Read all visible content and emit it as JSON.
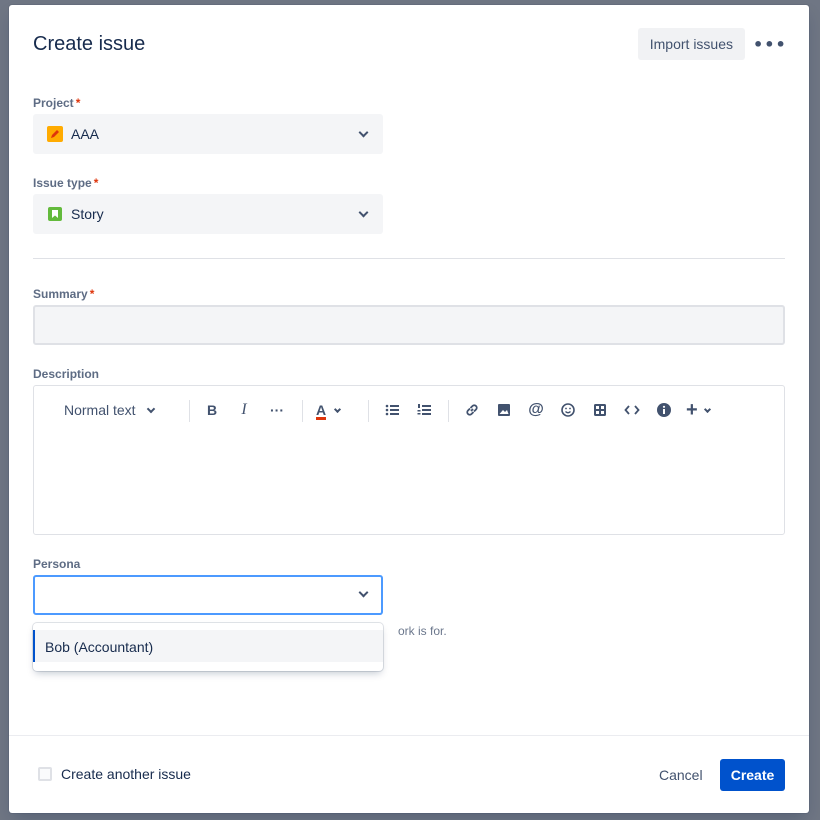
{
  "modal": {
    "title": "Create issue",
    "import_label": "Import issues",
    "more_label": "•••"
  },
  "project": {
    "label": "Project",
    "required": "*",
    "value": "AAA",
    "icon_color": "#ffab00"
  },
  "issue_type": {
    "label": "Issue type",
    "required": "*",
    "value": "Story",
    "icon_color": "#63ba3c"
  },
  "summary": {
    "label": "Summary",
    "required": "*",
    "value": ""
  },
  "description": {
    "label": "Description",
    "toolbar": {
      "text_style": "Normal text",
      "bold": "B",
      "italic": "I",
      "more": "···",
      "text_color": "A",
      "more_insert": "+"
    }
  },
  "persona": {
    "label": "Persona",
    "value": "",
    "helper_text": "ork is for.",
    "options": [
      "Bob (Accountant)"
    ]
  },
  "footer": {
    "create_another_label": "Create another issue",
    "create_another_checked": false,
    "cancel_label": "Cancel",
    "create_label": "Create",
    "primary_color": "#0052cc"
  }
}
